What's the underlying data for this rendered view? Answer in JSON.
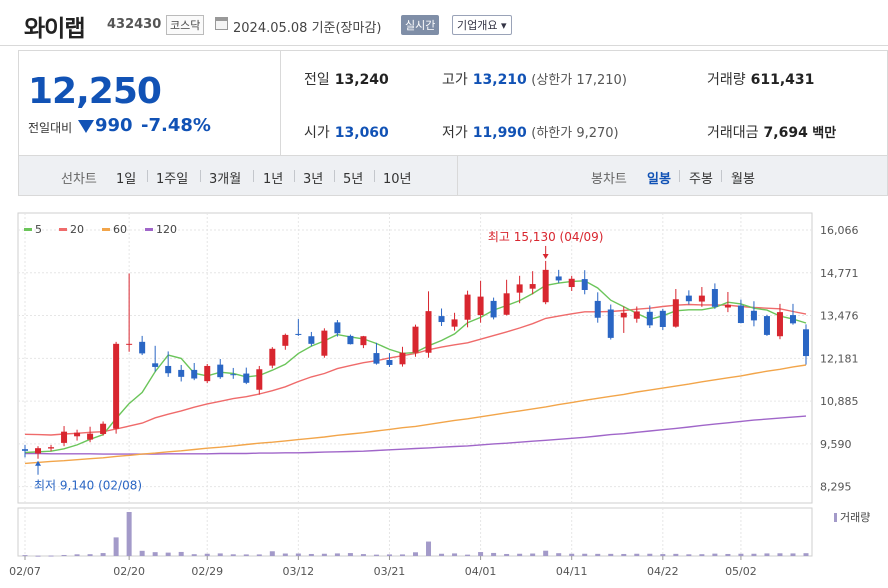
{
  "header": {
    "name": "와이랩",
    "code": "432430",
    "market": "코스닥",
    "date_text": "2024.05.08 기준(장마감)",
    "realtime_label": "실시간",
    "company_label": "기업개요 ▾"
  },
  "summary": {
    "current_price": "12,250",
    "change_label": "전일대비",
    "change_value": "990",
    "change_rate": "-7.48%",
    "prev_close_label": "전일",
    "prev_close": "13,240",
    "high_label": "고가",
    "high": "13,210",
    "upper_limit_text": "(상한가 17,210)",
    "volume_label": "거래량",
    "volume": "611,431",
    "open_label": "시가",
    "open": "13,060",
    "low_label": "저가",
    "low": "11,990",
    "lower_limit_text": "(하한가 9,270)",
    "amount_label": "거래대금",
    "amount": "7,694",
    "amount_unit": "백만"
  },
  "period_bar": {
    "line_chart_label": "선차트",
    "periods": [
      "1일",
      "1주일",
      "3개월",
      "1년",
      "3년",
      "5년",
      "10년"
    ],
    "candle_label": "봉차트",
    "candle_types": [
      "일봉",
      "주봉",
      "월봉"
    ],
    "active_candle": "일봉"
  },
  "colors": {
    "up": "#d8262f",
    "down": "#2a66c4",
    "ma5": "#6bc55a",
    "ma20": "#ef6b6b",
    "ma60": "#f2a54a",
    "ma120": "#a066c9",
    "volume": "#a39ac9"
  },
  "chart_data": {
    "type": "candlestick",
    "legend": [
      {
        "name": "5",
        "color": "#6bc55a"
      },
      {
        "name": "20",
        "color": "#ef6b6b"
      },
      {
        "name": "60",
        "color": "#f2a54a"
      },
      {
        "name": "120",
        "color": "#a066c9"
      }
    ],
    "y_ticks": [
      16066,
      14771,
      13476,
      12181,
      10885,
      9590,
      8295
    ],
    "ylim": [
      7800,
      16400
    ],
    "x_ticks": [
      {
        "i": 0,
        "label": "02/07"
      },
      {
        "i": 8,
        "label": "02/20"
      },
      {
        "i": 14,
        "label": "02/29"
      },
      {
        "i": 21,
        "label": "03/12"
      },
      {
        "i": 28,
        "label": "03/21"
      },
      {
        "i": 35,
        "label": "04/01"
      },
      {
        "i": 42,
        "label": "04/11"
      },
      {
        "i": 49,
        "label": "04/22"
      },
      {
        "i": 55,
        "label": "05/02"
      }
    ],
    "annotation_high": {
      "text": "최고 15,130 (04/09)",
      "index": 40,
      "value": 15130
    },
    "annotation_low": {
      "text": "최저 9,140 (02/08)",
      "index": 1,
      "value": 9140
    },
    "volume_label": "거래량",
    "candles": [
      {
        "o": 9430,
        "h": 9560,
        "l": 9180,
        "c": 9380
      },
      {
        "o": 9300,
        "h": 9520,
        "l": 9140,
        "c": 9460
      },
      {
        "o": 9450,
        "h": 9560,
        "l": 9370,
        "c": 9490
      },
      {
        "o": 9620,
        "h": 10130,
        "l": 9520,
        "c": 9960
      },
      {
        "o": 9820,
        "h": 10020,
        "l": 9690,
        "c": 9930
      },
      {
        "o": 9720,
        "h": 10110,
        "l": 9640,
        "c": 9900
      },
      {
        "o": 9890,
        "h": 10270,
        "l": 9840,
        "c": 10200
      },
      {
        "o": 10050,
        "h": 12680,
        "l": 9900,
        "c": 12620
      },
      {
        "o": 12620,
        "h": 14750,
        "l": 12380,
        "c": 12620
      },
      {
        "o": 12680,
        "h": 12860,
        "l": 12280,
        "c": 12330
      },
      {
        "o": 12030,
        "h": 12560,
        "l": 11780,
        "c": 11920
      },
      {
        "o": 11950,
        "h": 12390,
        "l": 11620,
        "c": 11730
      },
      {
        "o": 11830,
        "h": 11980,
        "l": 11480,
        "c": 11620
      },
      {
        "o": 11830,
        "h": 12040,
        "l": 11520,
        "c": 11570
      },
      {
        "o": 11490,
        "h": 12010,
        "l": 11430,
        "c": 11950
      },
      {
        "o": 11990,
        "h": 12160,
        "l": 11560,
        "c": 11610
      },
      {
        "o": 11700,
        "h": 11890,
        "l": 11560,
        "c": 11670
      },
      {
        "o": 11720,
        "h": 11900,
        "l": 11400,
        "c": 11440
      },
      {
        "o": 11230,
        "h": 11950,
        "l": 11080,
        "c": 11850
      },
      {
        "o": 11960,
        "h": 12520,
        "l": 11880,
        "c": 12470
      },
      {
        "o": 12560,
        "h": 12930,
        "l": 12440,
        "c": 12890
      },
      {
        "o": 12920,
        "h": 13370,
        "l": 12860,
        "c": 12900
      },
      {
        "o": 12850,
        "h": 12980,
        "l": 12550,
        "c": 12620
      },
      {
        "o": 12260,
        "h": 13090,
        "l": 12200,
        "c": 13020
      },
      {
        "o": 13270,
        "h": 13340,
        "l": 12840,
        "c": 12940
      },
      {
        "o": 12860,
        "h": 12900,
        "l": 12600,
        "c": 12610
      },
      {
        "o": 12580,
        "h": 12860,
        "l": 12490,
        "c": 12850
      },
      {
        "o": 12340,
        "h": 12650,
        "l": 11990,
        "c": 12020
      },
      {
        "o": 12130,
        "h": 12340,
        "l": 11920,
        "c": 11980
      },
      {
        "o": 12000,
        "h": 12530,
        "l": 11930,
        "c": 12350
      },
      {
        "o": 12350,
        "h": 13200,
        "l": 12230,
        "c": 13140
      },
      {
        "o": 12350,
        "h": 14210,
        "l": 12200,
        "c": 13610
      },
      {
        "o": 13460,
        "h": 13690,
        "l": 13160,
        "c": 13280
      },
      {
        "o": 13140,
        "h": 13560,
        "l": 13020,
        "c": 13360
      },
      {
        "o": 13350,
        "h": 14230,
        "l": 13120,
        "c": 14110
      },
      {
        "o": 13490,
        "h": 14530,
        "l": 13260,
        "c": 14050
      },
      {
        "o": 13920,
        "h": 14020,
        "l": 13360,
        "c": 13420
      },
      {
        "o": 13500,
        "h": 14560,
        "l": 13480,
        "c": 14150
      },
      {
        "o": 14170,
        "h": 14680,
        "l": 13850,
        "c": 14420
      },
      {
        "o": 14290,
        "h": 14820,
        "l": 14120,
        "c": 14430
      },
      {
        "o": 13880,
        "h": 15130,
        "l": 13820,
        "c": 14860
      },
      {
        "o": 14660,
        "h": 14860,
        "l": 14460,
        "c": 14540
      },
      {
        "o": 14340,
        "h": 14680,
        "l": 14220,
        "c": 14590
      },
      {
        "o": 14580,
        "h": 14850,
        "l": 14120,
        "c": 14250
      },
      {
        "o": 13920,
        "h": 14180,
        "l": 13260,
        "c": 13410
      },
      {
        "o": 13660,
        "h": 13810,
        "l": 12750,
        "c": 12800
      },
      {
        "o": 13420,
        "h": 13750,
        "l": 12950,
        "c": 13560
      },
      {
        "o": 13380,
        "h": 13750,
        "l": 13260,
        "c": 13600
      },
      {
        "o": 13590,
        "h": 13780,
        "l": 13100,
        "c": 13180
      },
      {
        "o": 13620,
        "h": 13680,
        "l": 13040,
        "c": 13130
      },
      {
        "o": 13140,
        "h": 14280,
        "l": 13110,
        "c": 13970
      },
      {
        "o": 14080,
        "h": 14240,
        "l": 13810,
        "c": 13910
      },
      {
        "o": 13900,
        "h": 14340,
        "l": 13740,
        "c": 14080
      },
      {
        "o": 14280,
        "h": 14450,
        "l": 13680,
        "c": 13740
      },
      {
        "o": 13720,
        "h": 14190,
        "l": 13580,
        "c": 13800
      },
      {
        "o": 13780,
        "h": 13960,
        "l": 13240,
        "c": 13250
      },
      {
        "o": 13620,
        "h": 13910,
        "l": 13150,
        "c": 13330
      },
      {
        "o": 13460,
        "h": 13500,
        "l": 12860,
        "c": 12890
      },
      {
        "o": 12850,
        "h": 13830,
        "l": 12760,
        "c": 13580
      },
      {
        "o": 13490,
        "h": 13830,
        "l": 13200,
        "c": 13240
      },
      {
        "o": 13060,
        "h": 13210,
        "l": 11990,
        "c": 12250
      }
    ],
    "ma5": [
      9330,
      9350,
      9370,
      9440,
      9560,
      9730,
      9870,
      10360,
      10810,
      11150,
      11780,
      12280,
      12180,
      11730,
      11650,
      11760,
      11720,
      11620,
      11660,
      11820,
      12000,
      12330,
      12550,
      12710,
      12900,
      12830,
      12770,
      12630,
      12450,
      12330,
      12360,
      12560,
      12720,
      12920,
      13260,
      13420,
      13640,
      13780,
      13930,
      14140,
      14390,
      14460,
      14510,
      14530,
      14310,
      13940,
      13740,
      13540,
      13360,
      13470,
      13620,
      13650,
      13650,
      13720,
      13880,
      13830,
      13700,
      13640,
      13460,
      13370,
      13250
    ],
    "ma20": [
      9880,
      9870,
      9860,
      9890,
      9910,
      9940,
      9960,
      10040,
      10130,
      10220,
      10380,
      10490,
      10590,
      10700,
      10800,
      10880,
      10960,
      11020,
      11100,
      11200,
      11320,
      11480,
      11620,
      11720,
      11870,
      11960,
      12050,
      12110,
      12190,
      12260,
      12330,
      12440,
      12520,
      12590,
      12650,
      12760,
      12870,
      12980,
      13100,
      13230,
      13390,
      13460,
      13530,
      13590,
      13590,
      13600,
      13630,
      13670,
      13700,
      13750,
      13790,
      13810,
      13800,
      13800,
      13790,
      13750,
      13720,
      13700,
      13680,
      13600,
      13520
    ],
    "ma60": [
      9000,
      9030,
      9060,
      9080,
      9110,
      9140,
      9170,
      9210,
      9240,
      9280,
      9310,
      9350,
      9380,
      9420,
      9460,
      9490,
      9530,
      9570,
      9610,
      9640,
      9680,
      9720,
      9760,
      9800,
      9850,
      9890,
      9930,
      9980,
      10030,
      10080,
      10120,
      10180,
      10240,
      10300,
      10350,
      10410,
      10470,
      10530,
      10590,
      10650,
      10710,
      10780,
      10840,
      10910,
      10970,
      11030,
      11090,
      11160,
      11220,
      11280,
      11340,
      11400,
      11470,
      11530,
      11590,
      11650,
      11720,
      11790,
      11850,
      11920,
      11980
    ],
    "ma120": [
      9300,
      9300,
      9290,
      9290,
      9290,
      9290,
      9280,
      9280,
      9280,
      9280,
      9280,
      9290,
      9290,
      9290,
      9290,
      9300,
      9300,
      9300,
      9310,
      9310,
      9320,
      9320,
      9330,
      9340,
      9350,
      9360,
      9370,
      9390,
      9410,
      9430,
      9450,
      9470,
      9490,
      9510,
      9530,
      9560,
      9590,
      9610,
      9640,
      9670,
      9700,
      9730,
      9760,
      9790,
      9830,
      9870,
      9900,
      9940,
      9980,
      10020,
      10060,
      10100,
      10150,
      10190,
      10230,
      10270,
      10310,
      10340,
      10370,
      10400,
      10430
    ],
    "volume": [
      80,
      30,
      40,
      90,
      150,
      160,
      260,
      1650,
      3900,
      460,
      340,
      300,
      360,
      160,
      200,
      230,
      150,
      140,
      140,
      420,
      220,
      220,
      180,
      200,
      230,
      260,
      170,
      120,
      140,
      140,
      330,
      1280,
      200,
      230,
      120,
      350,
      270,
      180,
      200,
      220,
      470,
      250,
      200,
      200,
      190,
      190,
      180,
      200,
      200,
      170,
      190,
      150,
      160,
      210,
      180,
      200,
      200,
      230,
      240,
      230,
      250
    ]
  }
}
